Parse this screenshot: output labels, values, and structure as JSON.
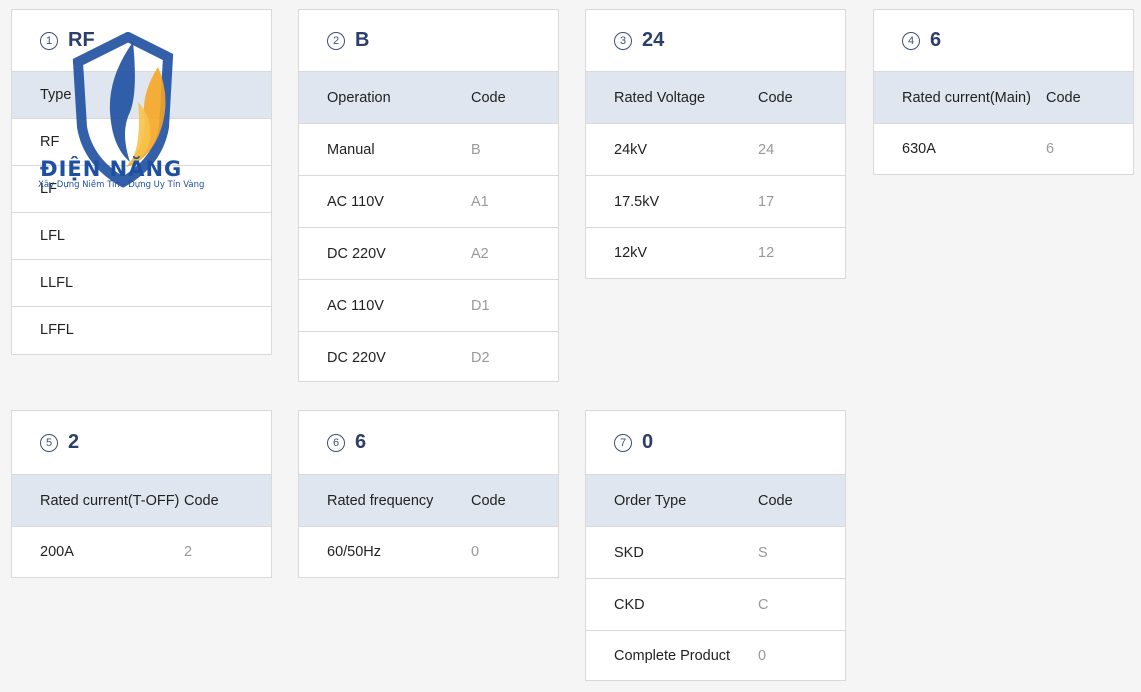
{
  "logo": {
    "name": "ĐIỆN NĂNG",
    "tagline": "Xây Dựng Niềm Tin - Dựng Uy Tín Vàng",
    "colors": {
      "blue": "#1e4fa0",
      "orange": "#f5a623"
    }
  },
  "cards": [
    {
      "num": "1",
      "title": "RF",
      "header": [
        "Type",
        ""
      ],
      "rows": [
        [
          "RF",
          ""
        ],
        [
          "LF",
          ""
        ],
        [
          "LFL",
          ""
        ],
        [
          "LLFL",
          ""
        ],
        [
          "LFFL",
          ""
        ]
      ]
    },
    {
      "num": "2",
      "title": "B",
      "header": [
        "Operation",
        "Code"
      ],
      "rows": [
        [
          "Manual",
          "B"
        ],
        [
          "AC 110V",
          "A1"
        ],
        [
          "DC 220V",
          "A2"
        ],
        [
          "AC 110V",
          "D1"
        ],
        [
          "DC 220V",
          "D2"
        ]
      ]
    },
    {
      "num": "3",
      "title": "24",
      "header": [
        "Rated Voltage",
        "Code"
      ],
      "rows": [
        [
          "24kV",
          "24"
        ],
        [
          "17.5kV",
          "17"
        ],
        [
          "12kV",
          "12"
        ]
      ]
    },
    {
      "num": "4",
      "title": "6",
      "header": [
        "Rated current(Main)",
        "Code"
      ],
      "rows": [
        [
          "630A",
          "6"
        ]
      ]
    },
    {
      "num": "5",
      "title": "2",
      "header": [
        "Rated current(T-OFF)",
        "Code"
      ],
      "rows": [
        [
          "200A",
          "2"
        ]
      ]
    },
    {
      "num": "6",
      "title": "6",
      "header": [
        "Rated frequency",
        "Code"
      ],
      "rows": [
        [
          "60/50Hz",
          "0"
        ]
      ]
    },
    {
      "num": "7",
      "title": "0",
      "header": [
        "Order Type",
        "Code"
      ],
      "rows": [
        [
          "SKD",
          "S"
        ],
        [
          "CKD",
          "C"
        ],
        [
          "Complete Product",
          "0"
        ]
      ]
    }
  ]
}
